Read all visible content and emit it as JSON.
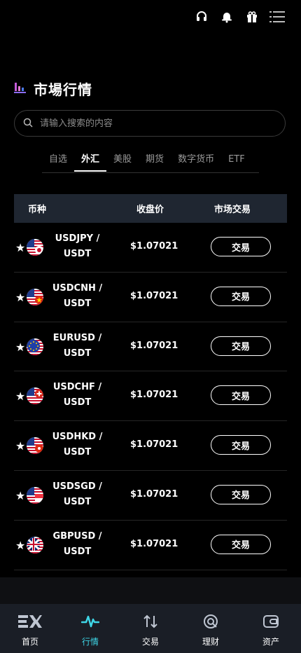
{
  "topbar": {
    "icons": [
      "headset-icon",
      "bell-icon",
      "gift-icon",
      "menu-icon"
    ]
  },
  "header": {
    "title": "市場行情"
  },
  "search": {
    "placeholder": "请输入搜索的内容"
  },
  "tabs": [
    {
      "label": "自选"
    },
    {
      "label": "外汇"
    },
    {
      "label": "美股"
    },
    {
      "label": "期货"
    },
    {
      "label": "数字货币"
    },
    {
      "label": "ETF"
    }
  ],
  "active_tab": "外汇",
  "table": {
    "columns": [
      "币种",
      "收盘价",
      "市场交易"
    ],
    "rows": [
      {
        "pair_line1": "USDJPY /",
        "pair_line2": "USDT",
        "price": "$1.07021",
        "action": "交易",
        "flag": "us-jp"
      },
      {
        "pair_line1": "USDCNH /",
        "pair_line2": "USDT",
        "price": "$1.07021",
        "action": "交易",
        "flag": "us-cn"
      },
      {
        "pair_line1": "EURUSD /",
        "pair_line2": "USDT",
        "price": "$1.07021",
        "action": "交易",
        "flag": "eu-us"
      },
      {
        "pair_line1": "USDCHF /",
        "pair_line2": "USDT",
        "price": "$1.07021",
        "action": "交易",
        "flag": "us-ch"
      },
      {
        "pair_line1": "USDHKD /",
        "pair_line2": "USDT",
        "price": "$1.07021",
        "action": "交易",
        "flag": "us-hk"
      },
      {
        "pair_line1": "USDSGD /",
        "pair_line2": "USDT",
        "price": "$1.07021",
        "action": "交易",
        "flag": "us-sg"
      },
      {
        "pair_line1": "GBPUSD /",
        "pair_line2": "USDT",
        "price": "$1.07021",
        "action": "交易",
        "flag": "gb-us"
      }
    ]
  },
  "bottom_nav": [
    {
      "label": "首页",
      "icon": "ex-logo-icon"
    },
    {
      "label": "行情",
      "icon": "pulse-icon",
      "active": true
    },
    {
      "label": "交易",
      "icon": "swap-arrows-icon"
    },
    {
      "label": "理财",
      "icon": "finance-icon"
    },
    {
      "label": "资产",
      "icon": "wallet-icon"
    }
  ],
  "colors": {
    "background": "#000000",
    "accent": "#3fd6e6",
    "table_header": "#1f2631",
    "bottom_nav": "#1a1e26"
  }
}
